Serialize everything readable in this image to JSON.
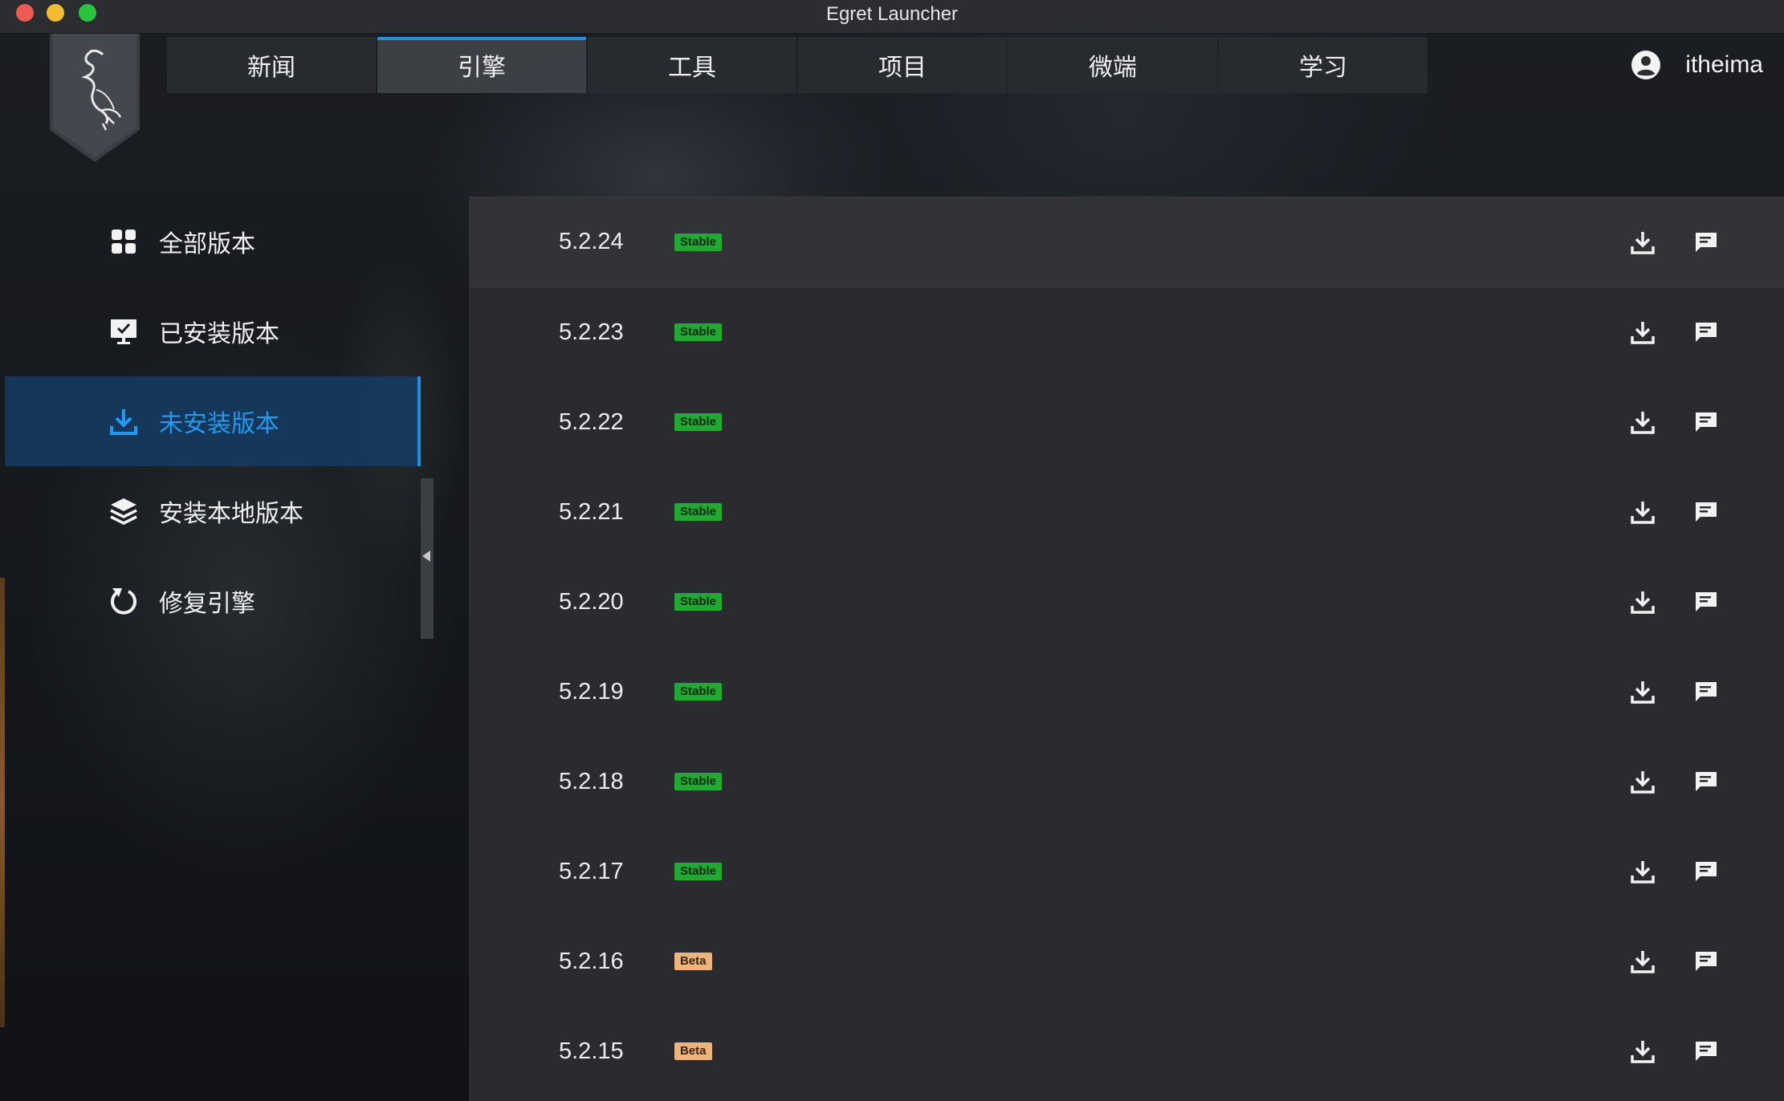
{
  "window": {
    "title": "Egret Launcher"
  },
  "nav": {
    "tabs": [
      {
        "label": "新闻",
        "active": false
      },
      {
        "label": "引擎",
        "active": true
      },
      {
        "label": "工具",
        "active": false
      },
      {
        "label": "项目",
        "active": false
      },
      {
        "label": "微端",
        "active": false
      },
      {
        "label": "学习",
        "active": false
      }
    ],
    "user": {
      "name": "itheima",
      "icon": "user-circle-icon"
    }
  },
  "sidebar": {
    "items": [
      {
        "label": "全部版本",
        "icon": "grid-icon",
        "active": false
      },
      {
        "label": "已安装版本",
        "icon": "monitor-check-icon",
        "active": false
      },
      {
        "label": "未安装版本",
        "icon": "download-icon",
        "active": true
      },
      {
        "label": "安装本地版本",
        "icon": "layers-icon",
        "active": false
      },
      {
        "label": "修复引擎",
        "icon": "refresh-icon",
        "active": false
      }
    ]
  },
  "versions": [
    {
      "version": "5.2.24",
      "tag": "Stable"
    },
    {
      "version": "5.2.23",
      "tag": "Stable"
    },
    {
      "version": "5.2.22",
      "tag": "Stable"
    },
    {
      "version": "5.2.21",
      "tag": "Stable"
    },
    {
      "version": "5.2.20",
      "tag": "Stable"
    },
    {
      "version": "5.2.19",
      "tag": "Stable"
    },
    {
      "version": "5.2.18",
      "tag": "Stable"
    },
    {
      "version": "5.2.17",
      "tag": "Stable"
    },
    {
      "version": "5.2.16",
      "tag": "Beta"
    },
    {
      "version": "5.2.15",
      "tag": "Beta"
    }
  ],
  "colors": {
    "accent": "#1f8fe0",
    "stable": "#1faa32",
    "beta": "#f0b37a"
  }
}
